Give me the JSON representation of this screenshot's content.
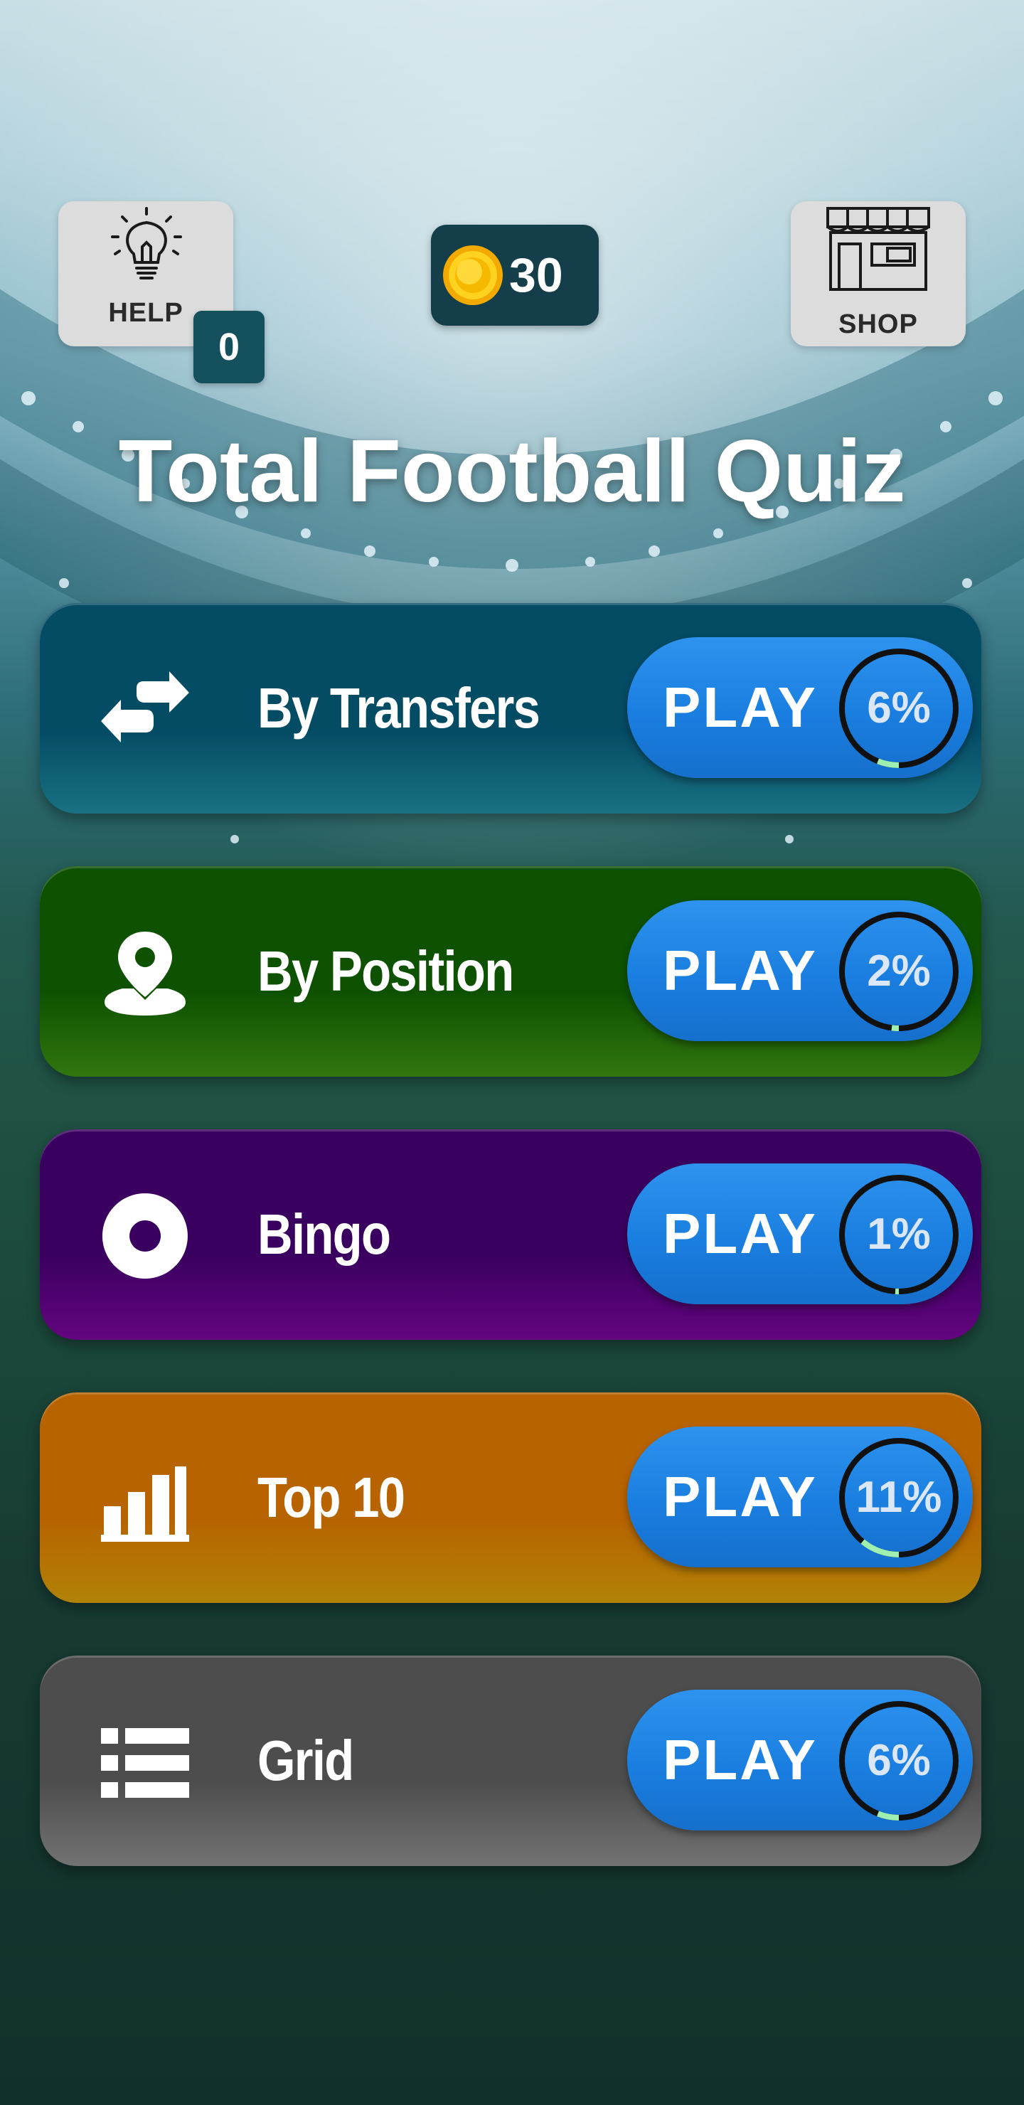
{
  "header": {
    "help_label": "HELP",
    "hints_count": "0",
    "coins": "30",
    "shop_label": "SHOP"
  },
  "title": "Total Football Quiz",
  "play_label": "PLAY",
  "modes": [
    {
      "name": "By Transfers",
      "progress": "6%",
      "progress_value": 0.06,
      "color": "#1f8aa0",
      "icon": "transfer-arrows-icon"
    },
    {
      "name": "By Position",
      "progress": "2%",
      "progress_value": 0.02,
      "color": "#3c9012",
      "icon": "map-pin-icon"
    },
    {
      "name": "Bingo",
      "progress": "1%",
      "progress_value": 0.01,
      "color": "#7a069c",
      "icon": "ring-icon"
    },
    {
      "name": "Top 10",
      "progress": "11%",
      "progress_value": 0.11,
      "color": "#d89f08",
      "icon": "bar-chart-icon"
    },
    {
      "name": "Grid",
      "progress": "6%",
      "progress_value": 0.06,
      "color": "#8c8c8c",
      "icon": "list-icon"
    }
  ],
  "colors": {
    "play_button": "#1a7ee0",
    "progress_fill": "#9ff0b0",
    "coin": "#f5b700"
  }
}
